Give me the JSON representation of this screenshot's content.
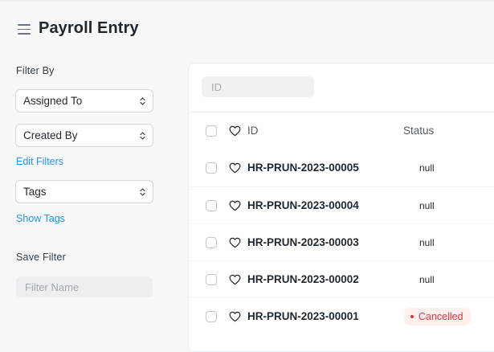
{
  "header": {
    "title": "Payroll Entry",
    "menu_icon": "hamburger-icon"
  },
  "sidebar": {
    "filter_by_label": "Filter By",
    "assigned_to": "Assigned To",
    "created_by": "Created By",
    "edit_filters": "Edit Filters",
    "tags": "Tags",
    "show_tags": "Show Tags",
    "save_filter_label": "Save Filter",
    "filter_name_placeholder": "Filter Name"
  },
  "list": {
    "search_placeholder": "ID",
    "columns": {
      "id": "ID",
      "status": "Status"
    },
    "rows": [
      {
        "id": "HR-PRUN-2023-00005",
        "status": "null"
      },
      {
        "id": "HR-PRUN-2023-00004",
        "status": "null"
      },
      {
        "id": "HR-PRUN-2023-00003",
        "status": "null"
      },
      {
        "id": "HR-PRUN-2023-00002",
        "status": "null"
      },
      {
        "id": "HR-PRUN-2023-00001",
        "status": "Cancelled"
      }
    ]
  },
  "colors": {
    "accent": "#2490ef",
    "cancelled": "#e03636",
    "cancelled_bg": "#fff0f0"
  }
}
